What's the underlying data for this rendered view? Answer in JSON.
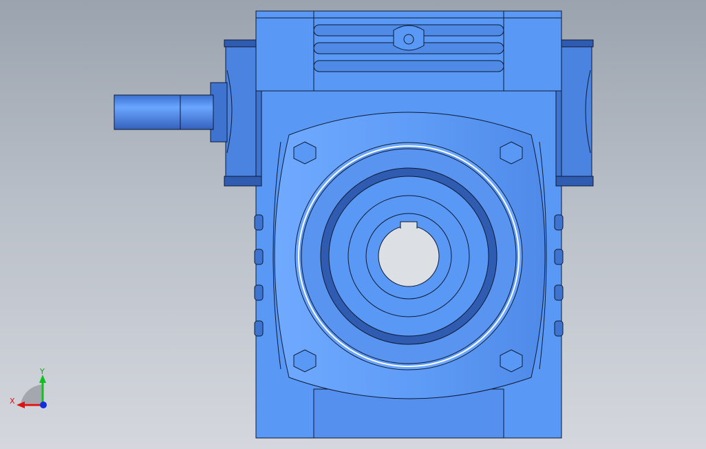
{
  "viewport": {
    "model_name": "worm-gear-reducer",
    "colors": {
      "body": "#5a98f5",
      "body_light": "#6fa8ff",
      "body_dark": "#3e74d0",
      "shade": "#2f5cb0",
      "edge": "#0c1a33",
      "bore": "#dcdfe4"
    }
  },
  "triad": {
    "x_label": "X",
    "y_label": "Y",
    "colors": {
      "x": "#e01010",
      "y": "#10c020",
      "z": "#1030e0"
    }
  }
}
